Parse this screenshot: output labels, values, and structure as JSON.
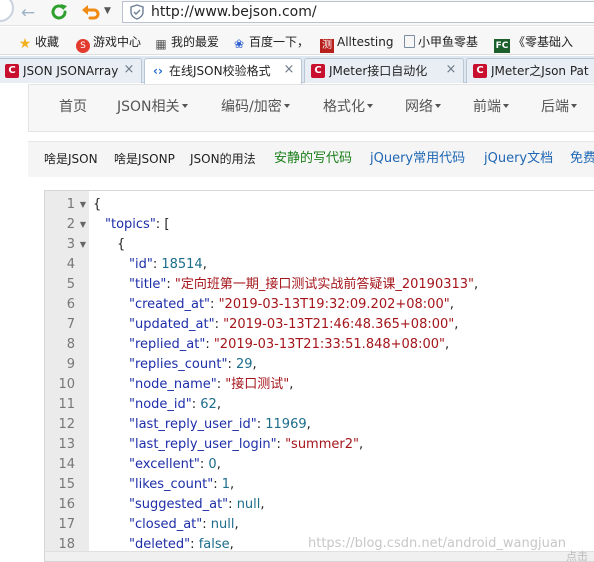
{
  "browser": {
    "url": "http://www.bejson.com/",
    "bookmarks": [
      {
        "label": "收藏",
        "icon": "star-icon"
      },
      {
        "label": "游戏中心",
        "icon": "game-icon"
      },
      {
        "label": "我的最爱",
        "icon": "grid-icon"
      },
      {
        "label": "百度一下，",
        "icon": "baidu-paw-icon"
      },
      {
        "label": "Alltesting",
        "icon": "alltesting-logo-icon"
      },
      {
        "label": "小甲鱼零基",
        "icon": "page-icon"
      },
      {
        "label": "《零基础入",
        "icon": "fc-logo-icon"
      }
    ],
    "tabs": [
      {
        "title": "JSON JSONArray",
        "favicon": "C",
        "active": false
      },
      {
        "title": "在线JSON校验格式",
        "favicon": "‹›",
        "active": true
      },
      {
        "title": "JMeter接口自动化",
        "favicon": "C",
        "active": false
      },
      {
        "title": "JMeter之Json Pat",
        "favicon": "C",
        "active": false
      }
    ]
  },
  "site_nav": {
    "items": [
      {
        "label": "首页",
        "dropdown": false
      },
      {
        "label": "JSON相关",
        "dropdown": true
      },
      {
        "label": "编码/加密",
        "dropdown": true
      },
      {
        "label": "格式化",
        "dropdown": true
      },
      {
        "label": "网络",
        "dropdown": true
      },
      {
        "label": "前端",
        "dropdown": true
      },
      {
        "label": "后端",
        "dropdown": true
      }
    ]
  },
  "sub_links": [
    {
      "label": "啥是JSON",
      "style": "dark"
    },
    {
      "label": "啥是JSONP",
      "style": "dark"
    },
    {
      "label": "JSON的用法",
      "style": "dark"
    },
    {
      "label": "安静的写代码",
      "style": "green"
    },
    {
      "label": "jQuery常用代码",
      "style": "blue"
    },
    {
      "label": "jQuery文档",
      "style": "blue"
    },
    {
      "label": "免费",
      "style": "blue"
    }
  ],
  "editor": {
    "line_numbers": [
      "1",
      "2",
      "3",
      "4",
      "5",
      "6",
      "7",
      "8",
      "9",
      "10",
      "11",
      "12",
      "13",
      "14",
      "15",
      "16",
      "17",
      "18"
    ],
    "lines": [
      {
        "indent": 0,
        "text": "{"
      },
      {
        "indent": 1,
        "key": "\"topics\"",
        "sep": ": ",
        "text": "["
      },
      {
        "indent": 2,
        "text": "{"
      },
      {
        "indent": 3,
        "key": "\"id\"",
        "sep": ": ",
        "num": "18514",
        "tail": ","
      },
      {
        "indent": 3,
        "key": "\"title\"",
        "sep": ": ",
        "str": "\"定向班第一期_接口测试实战前答疑课_20190313\"",
        "tail": ","
      },
      {
        "indent": 3,
        "key": "\"created_at\"",
        "sep": ": ",
        "str": "\"2019-03-13T19:32:09.202+08:00\"",
        "tail": ","
      },
      {
        "indent": 3,
        "key": "\"updated_at\"",
        "sep": ": ",
        "str": "\"2019-03-13T21:46:48.365+08:00\"",
        "tail": ","
      },
      {
        "indent": 3,
        "key": "\"replied_at\"",
        "sep": ": ",
        "str": "\"2019-03-13T21:33:51.848+08:00\"",
        "tail": ","
      },
      {
        "indent": 3,
        "key": "\"replies_count\"",
        "sep": ": ",
        "num": "29",
        "tail": ","
      },
      {
        "indent": 3,
        "key": "\"node_name\"",
        "sep": ": ",
        "str": "\"接口测试\"",
        "tail": ","
      },
      {
        "indent": 3,
        "key": "\"node_id\"",
        "sep": ": ",
        "num": "62",
        "tail": ","
      },
      {
        "indent": 3,
        "key": "\"last_reply_user_id\"",
        "sep": ": ",
        "num": "11969",
        "tail": ","
      },
      {
        "indent": 3,
        "key": "\"last_reply_user_login\"",
        "sep": ": ",
        "str": "\"summer2\"",
        "tail": ","
      },
      {
        "indent": 3,
        "key": "\"excellent\"",
        "sep": ": ",
        "num": "0",
        "tail": ","
      },
      {
        "indent": 3,
        "key": "\"likes_count\"",
        "sep": ": ",
        "num": "1",
        "tail": ","
      },
      {
        "indent": 3,
        "key": "\"suggested_at\"",
        "sep": ": ",
        "kw": "null",
        "tail": ","
      },
      {
        "indent": 3,
        "key": "\"closed_at\"",
        "sep": ": ",
        "kw": "null",
        "tail": ","
      },
      {
        "indent": 3,
        "key": "\"deleted\"",
        "sep": ": ",
        "kw": "false",
        "tail": ","
      }
    ],
    "fold_markers": [
      "1",
      "2",
      "3"
    ]
  },
  "watermark": "https://blog.csdn.net/android_wangjuan",
  "corner_text": "点击"
}
